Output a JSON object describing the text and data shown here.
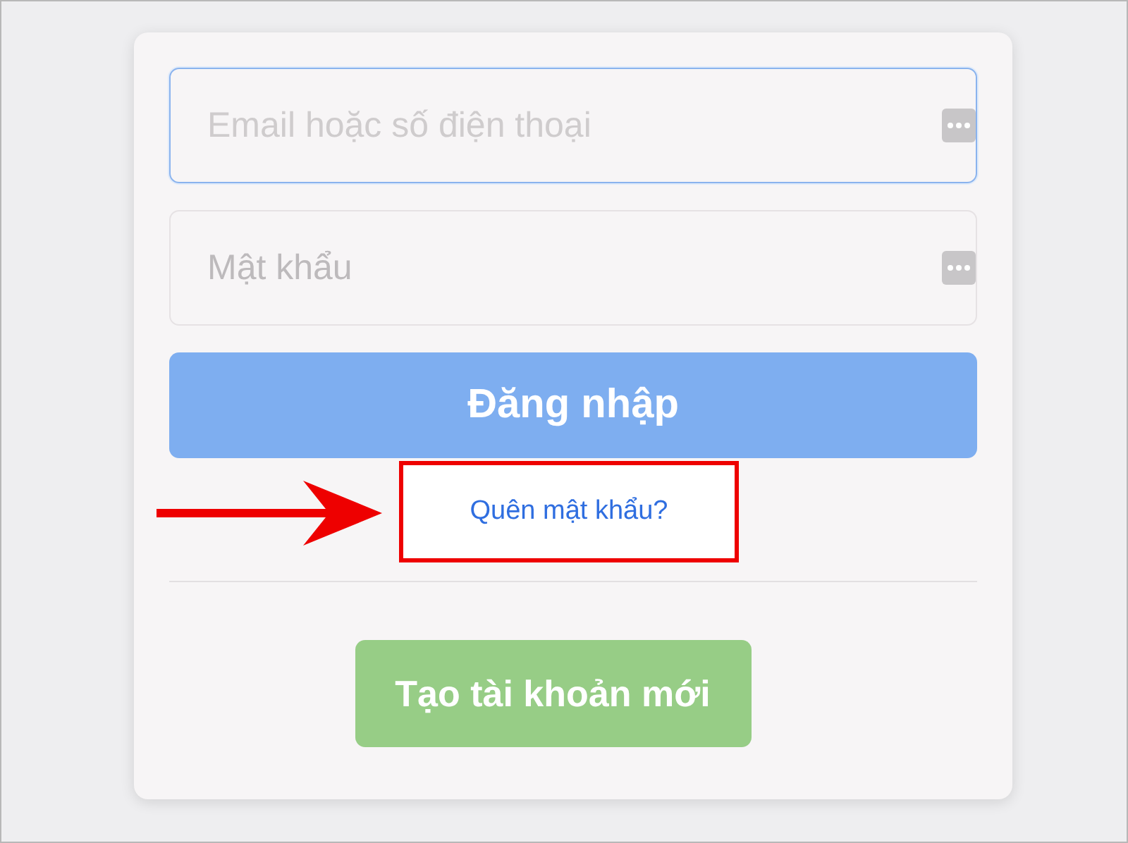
{
  "fields": [
    {
      "placeholder": "Email hoặc số điện thoại",
      "focused": true
    },
    {
      "placeholder": "Mật khẩu",
      "focused": false
    }
  ],
  "login_button": "Đăng nhập",
  "forgot_link": {
    "label": "Quên mật khẩu?",
    "highlighted": true
  },
  "create_button": "Tạo tài khoản mới"
}
